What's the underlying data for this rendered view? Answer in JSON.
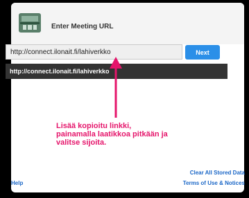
{
  "header": {
    "title": "Enter Meeting URL",
    "logo_icon": "meeting-room-icon"
  },
  "url": {
    "value": "http://connect.ilonait.fi/lahiverkko"
  },
  "next_label": "Next",
  "suggestion": {
    "text": "http://connect.ilonait.fi/lahiverkko"
  },
  "annotation": {
    "line1": "Lisää kopioitu linkki,",
    "line2": "painamalla laatikkoa pitkään ja",
    "line3": "valitse sijoita."
  },
  "footer": {
    "clear_label": "Clear All Stored Data",
    "terms_label": "Terms of Use & Notices",
    "help_label": "Help"
  },
  "colors": {
    "accent": "#2b8fe8",
    "annotation": "#e5156b",
    "link": "#1b67c7"
  }
}
